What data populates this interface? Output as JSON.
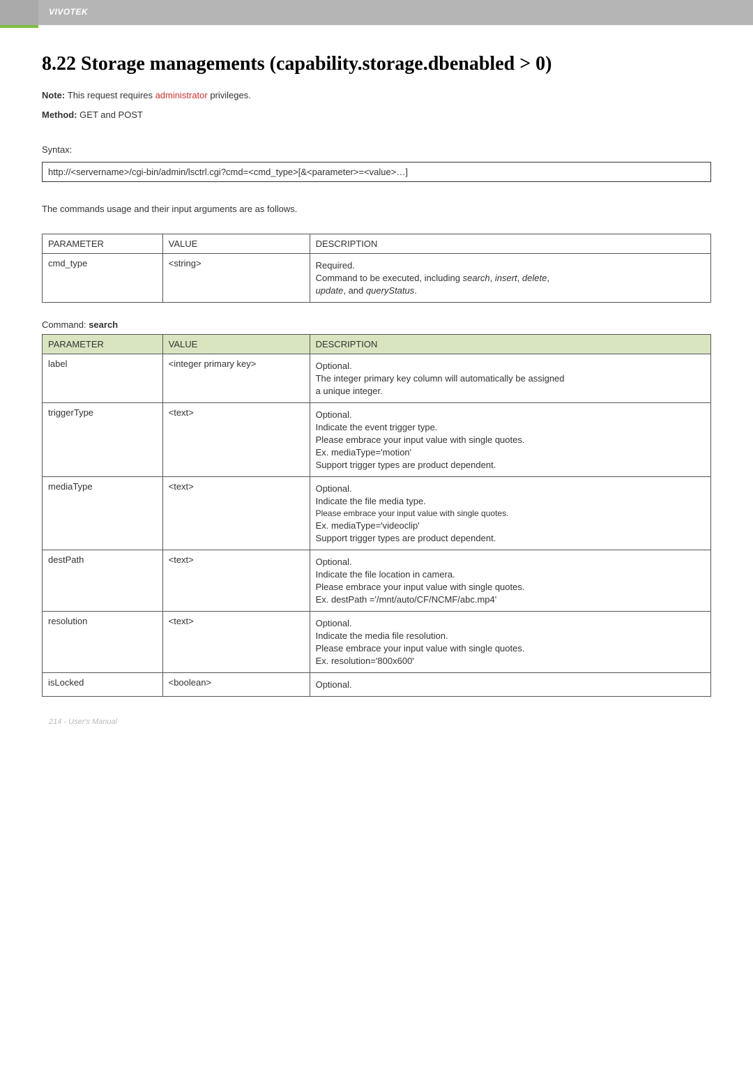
{
  "brand": "VIVOTEK",
  "heading": "8.22 Storage managements (capability.storage.dbenabled > 0)",
  "note_prefix": "Note: ",
  "note_text_before": "This request requires ",
  "note_admin": "administrator",
  "note_text_after": " privileges.",
  "method_label": "Method: ",
  "method_text": "GET and POST",
  "syntax_label": "Syntax:",
  "syntax_box": "http://<servername>/cgi-bin/admin/lsctrl.cgi?cmd=<cmd_type>[&<parameter>=<value>…]",
  "cmd_intro": "The commands usage and their input arguments are as follows.",
  "t1_headers": {
    "param": "PARAMETER",
    "value": "VALUE",
    "desc": "DESCRIPTION"
  },
  "t1_row": {
    "param": "cmd_type",
    "value": "<string>",
    "desc_lines": [
      "Required.",
      "Command to be executed, including search, insert, delete,",
      "update, and queryStatus."
    ]
  },
  "command_label_prefix": "Command: ",
  "command_label_bold": "search",
  "t2_headers": {
    "param": "PARAMETER",
    "value": "VALUE",
    "desc": "DESCRIPTION"
  },
  "t2_rows": [
    {
      "param": "label",
      "value": "<integer primary key>",
      "desc": [
        "Optional.",
        "The integer primary key column will automatically be assigned",
        "a unique integer."
      ]
    },
    {
      "param": "triggerType",
      "value": "<text>",
      "desc": [
        "Optional.",
        "Indicate the event trigger type.",
        "Please embrace your input value with single quotes.",
        "Ex. mediaType='motion'",
        "Support trigger types are product dependent."
      ]
    },
    {
      "param": "mediaType",
      "value": "<text>",
      "desc": [
        "Optional.",
        "Indicate the file media type.",
        {
          "text": "Please embrace your input value with single quotes.",
          "small": true
        },
        "Ex. mediaType='videoclip'",
        "Support trigger types are product dependent."
      ]
    },
    {
      "param": "destPath",
      "value": "<text>",
      "desc": [
        "Optional.",
        "Indicate the file location in camera.",
        "Please embrace your input value with single quotes.",
        "Ex. destPath ='/mnt/auto/CF/NCMF/abc.mp4'"
      ]
    },
    {
      "param": "resolution",
      "value": "<text>",
      "desc": [
        "Optional.",
        "Indicate the media file resolution.",
        "Please embrace your input value with single quotes.",
        "Ex. resolution='800x600'"
      ]
    },
    {
      "param": "isLocked",
      "value": "<boolean>",
      "desc": [
        "Optional."
      ]
    }
  ],
  "footer": "214 - User's Manual"
}
